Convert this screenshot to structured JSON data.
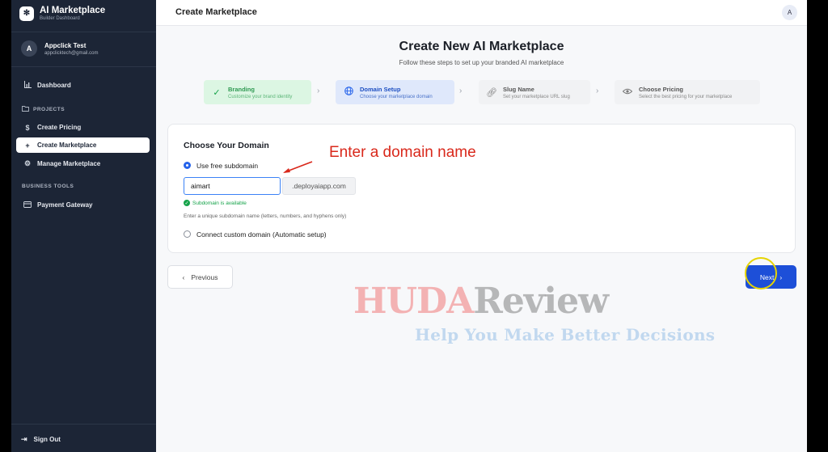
{
  "sidebar": {
    "brand_title": "AI Marketplace",
    "brand_subtitle": "Builder Dashboard",
    "user": {
      "avatar": "A",
      "name": "Appclick Test",
      "email": "appclicktech@gmail.com"
    },
    "dashboard_label": "Dashboard",
    "projects_label": "PROJECTS",
    "items": [
      {
        "label": "Create Pricing",
        "icon": "dollar-icon"
      },
      {
        "label": "Create Marketplace",
        "icon": "plus-icon",
        "active": true
      },
      {
        "label": "Manage Marketplace",
        "icon": "gear-icon"
      }
    ],
    "business_tools_label": "BUSINESS TOOLS",
    "payment_label": "Payment Gateway",
    "signout_label": "Sign Out"
  },
  "topbar": {
    "title": "Create Marketplace",
    "avatar": "A"
  },
  "main": {
    "title": "Create New AI Marketplace",
    "subtitle": "Follow these steps to set up your branded AI marketplace",
    "steps": [
      {
        "title": "Branding",
        "subtitle": "Customize your brand identity",
        "state": "complete",
        "icon": "check-icon"
      },
      {
        "title": "Domain Setup",
        "subtitle": "Choose your marketplace domain",
        "state": "active",
        "icon": "globe-icon"
      },
      {
        "title": "Slug Name",
        "subtitle": "Set your marketplace URL slug",
        "state": "pending",
        "icon": "link-icon"
      },
      {
        "title": "Choose Pricing",
        "subtitle": "Select the best pricing for your marketplace",
        "state": "pending",
        "icon": "eye-icon"
      }
    ],
    "card": {
      "title": "Choose Your Domain",
      "option_free": "Use free subdomain",
      "subdomain_value": "aimart",
      "domain_suffix": ".deployaiapp.com",
      "available_text": "Subdomain is available",
      "hint": "Enter a unique subdomain name (letters, numbers, and hyphens only)",
      "option_custom": "Connect custom domain (Automatic setup)"
    },
    "annotation": "Enter a domain name",
    "previous_label": "Previous",
    "next_label": "Next"
  },
  "watermark": {
    "part1": "HUDA",
    "part2": "Review",
    "tagline": "Help You Make Better Decisions"
  },
  "colors": {
    "sidebar_bg": "#1c2536",
    "accent": "#1d4fd8",
    "success": "#16a34a",
    "annotation": "#d9281b"
  }
}
